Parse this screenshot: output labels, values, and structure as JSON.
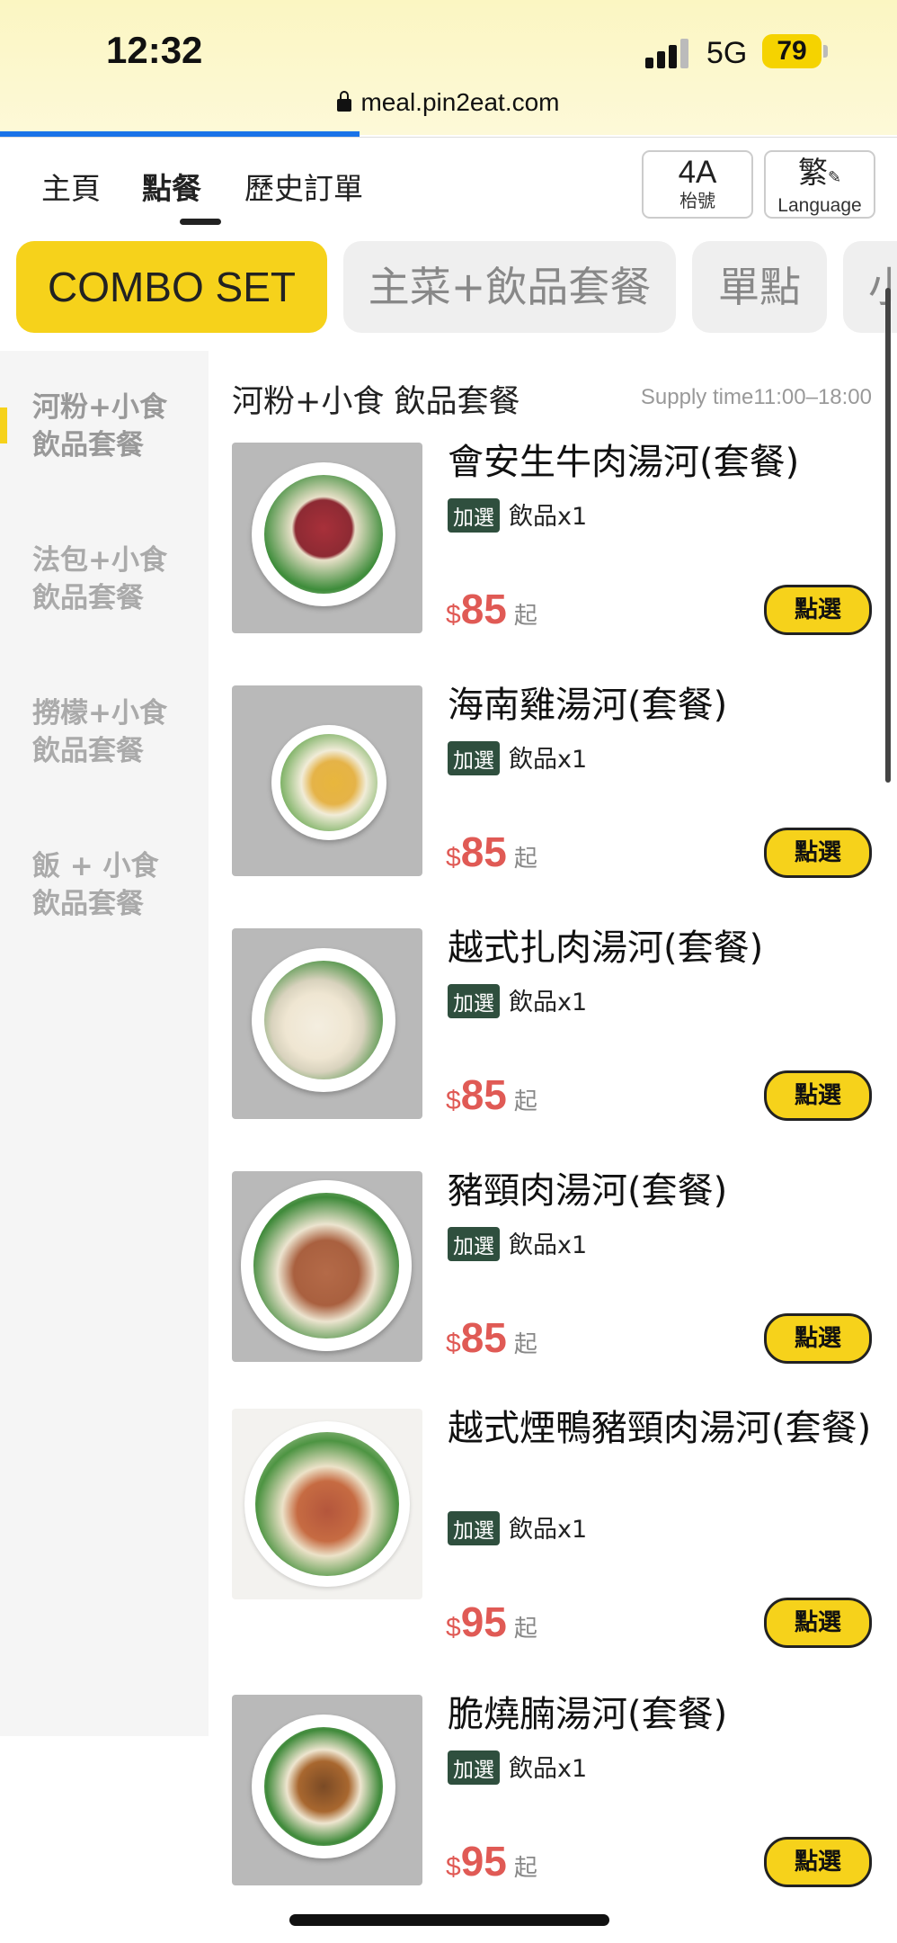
{
  "status_bar": {
    "time": "12:32",
    "network": "5G",
    "battery": "79",
    "url": "meal.pin2eat.com"
  },
  "nav": {
    "tabs": [
      "主頁",
      "點餐",
      "歷史訂單"
    ],
    "table_number": "4A",
    "table_label": "枱號",
    "language_char": "繁",
    "language_label": "Language"
  },
  "categories": [
    "COMBO SET",
    "主菜+飲品套餐",
    "單點",
    "小"
  ],
  "sidebar": {
    "items": [
      [
        "河粉+小食",
        "飲品套餐"
      ],
      [
        "法包+小食",
        "飲品套餐"
      ],
      [
        "撈檬+小食",
        "飲品套餐"
      ],
      [
        "飯 + 小食",
        "飲品套餐"
      ]
    ]
  },
  "section": {
    "title": "河粉+小食 飲品套餐",
    "supply_time": "Supply time11:00–18:00"
  },
  "option_badge": "加選",
  "option_text": "飲品x1",
  "price_currency": "$",
  "price_from": "起",
  "select_label": "點選",
  "items": [
    {
      "name": "會安生牛肉湯河(套餐)",
      "price": "85"
    },
    {
      "name": "海南雞湯河(套餐)",
      "price": "85"
    },
    {
      "name": "越式扎肉湯河(套餐)",
      "price": "85"
    },
    {
      "name": "豬頸肉湯河(套餐)",
      "price": "85"
    },
    {
      "name": "越式煙鴨豬頸肉湯河(套餐)",
      "price": "95"
    },
    {
      "name": "脆燒腩湯河(套餐)",
      "price": "95"
    }
  ],
  "colors": {
    "accent": "#f6d21b",
    "price": "#e05a55",
    "badge": "#2f4f3e"
  }
}
